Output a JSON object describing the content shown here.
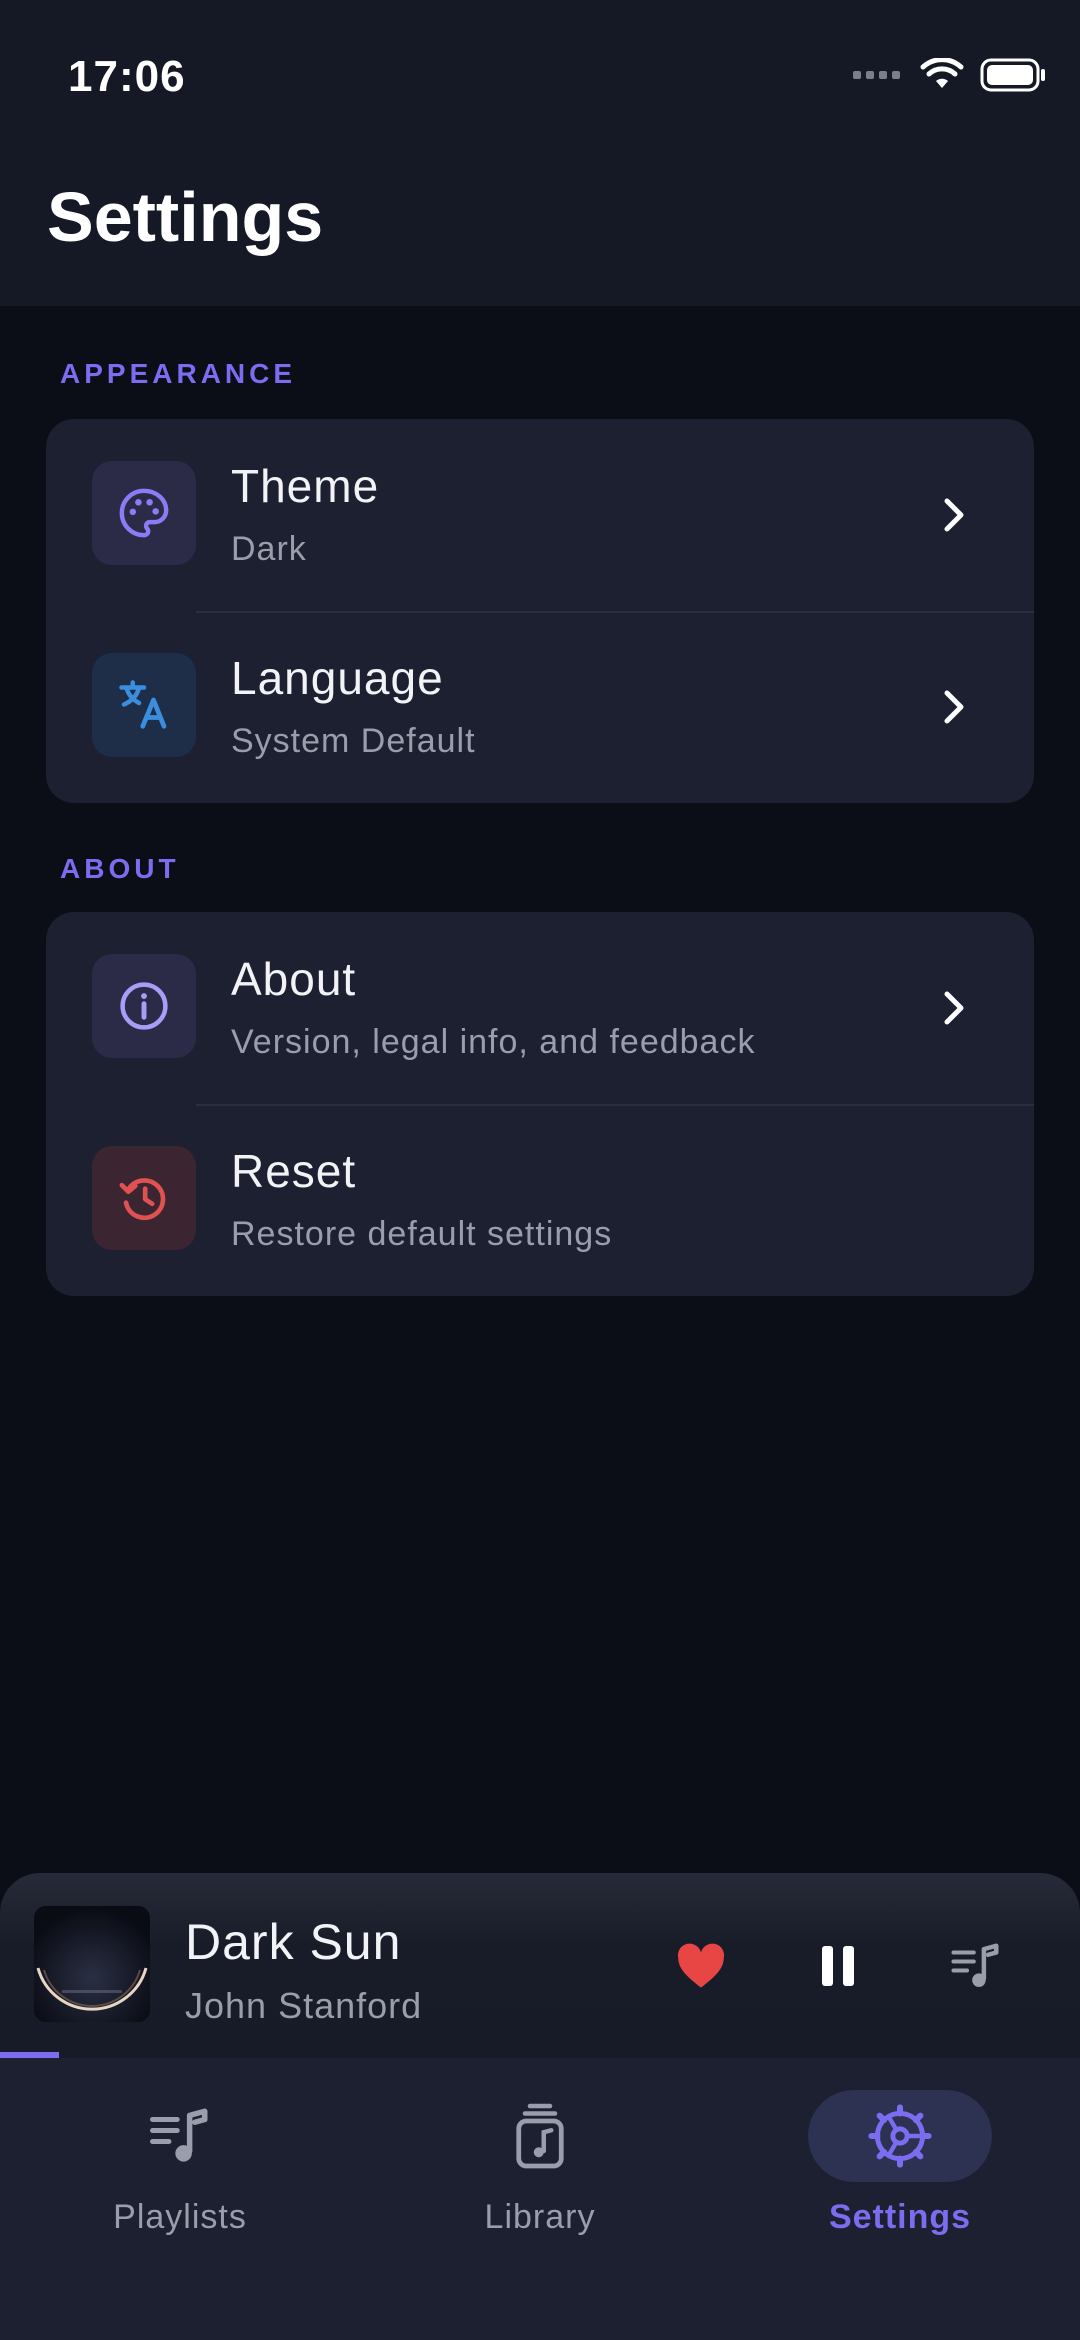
{
  "status_bar": {
    "time": "17:06"
  },
  "header": {
    "title": "Settings"
  },
  "sections": [
    {
      "label": "APPEARANCE",
      "items": [
        {
          "title": "Theme",
          "subtitle": "Dark",
          "icon": "palette-icon",
          "icon_color": "#8b7cf6",
          "has_chevron": true
        },
        {
          "title": "Language",
          "subtitle": "System Default",
          "icon": "translate-icon",
          "icon_color": "#3b8ede",
          "has_chevron": true
        }
      ]
    },
    {
      "label": "ABOUT",
      "items": [
        {
          "title": "About",
          "subtitle": "Version, legal info, and feedback",
          "icon": "info-icon",
          "icon_color": "#a89df7",
          "has_chevron": true
        },
        {
          "title": "Reset",
          "subtitle": "Restore default settings",
          "icon": "history-icon",
          "icon_color": "#e05252",
          "has_chevron": false
        }
      ]
    }
  ],
  "mini_player": {
    "title": "Dark Sun",
    "artist": "John Stanford",
    "progress_percent": 5.5,
    "liked": true,
    "state": "playing"
  },
  "tab_bar": {
    "tabs": [
      {
        "label": "Playlists",
        "icon": "playlist-music-icon",
        "active": false
      },
      {
        "label": "Library",
        "icon": "music-library-icon",
        "active": false
      },
      {
        "label": "Settings",
        "icon": "settings-gear-icon",
        "active": true
      }
    ]
  },
  "colors": {
    "accent": "#7b6cf0",
    "background": "#0b0e16",
    "card": "#1d2030",
    "heart": "#e84545"
  }
}
